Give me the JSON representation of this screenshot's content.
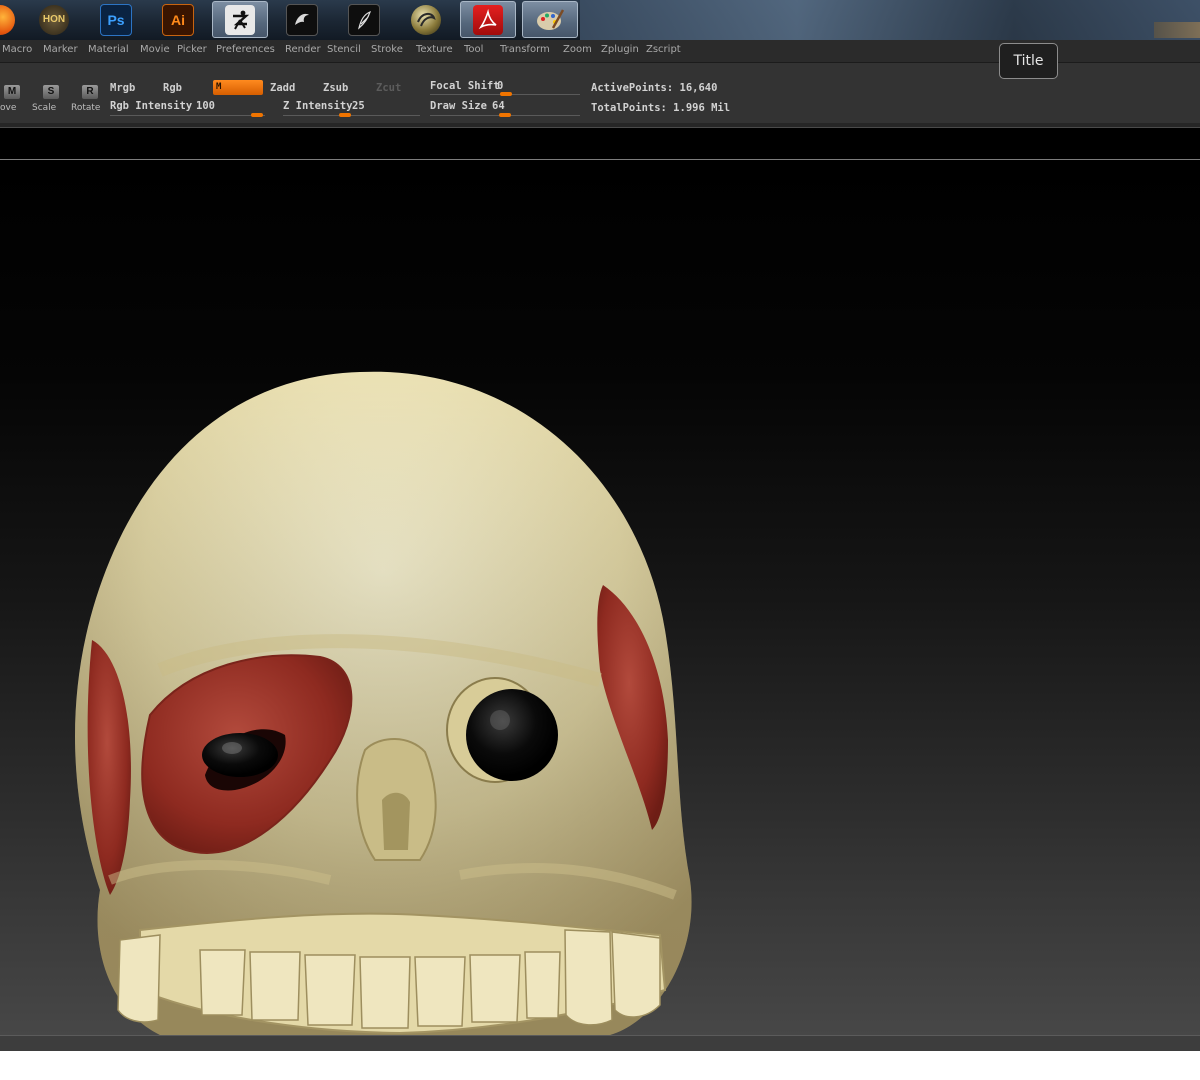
{
  "taskbar": {
    "apps": [
      {
        "name": "firefox",
        "label": ""
      },
      {
        "name": "hon",
        "label": "HON"
      },
      {
        "name": "photoshop",
        "label": "Ps"
      },
      {
        "name": "illustrator",
        "label": "Ai"
      },
      {
        "name": "zbrush",
        "label": "Z",
        "active": true
      },
      {
        "name": "app-dolphin",
        "label": ""
      },
      {
        "name": "app-feather",
        "label": ""
      },
      {
        "name": "app-sphere",
        "label": ""
      },
      {
        "name": "acrobat",
        "label": "⅄",
        "active": true
      },
      {
        "name": "paint",
        "label": "",
        "active": true
      }
    ]
  },
  "menu": {
    "items": [
      "Macro",
      "Marker",
      "Material",
      "Movie",
      "Picker",
      "Preferences",
      "Render",
      "Stencil",
      "Stroke",
      "Texture",
      "Tool",
      "Transform",
      "Zoom",
      "Zplugin",
      "Zscript"
    ]
  },
  "toolbar": {
    "move_short": "M",
    "move_label": "ove",
    "scale_short": "S",
    "scale_label": "Scale",
    "rotate_short": "R",
    "rotate_label": "Rotate",
    "mrgb": "Mrgb",
    "rgb": "Rgb",
    "m_button": "M",
    "zadd": "Zadd",
    "zsub": "Zsub",
    "zcut": "Zcut",
    "rgb_intensity_label": "Rgb Intensity",
    "rgb_intensity_value": "100",
    "z_intensity_label": "Z Intensity",
    "z_intensity_value": "25",
    "focal_shift_label": "Focal Shift",
    "focal_shift_value": "0",
    "draw_size_label": "Draw Size",
    "draw_size_value": "64",
    "active_points": "ActivePoints: 16,640",
    "total_points": "TotalPoints: 1.996 Mil"
  },
  "tooltip": {
    "text": "Title"
  },
  "colors": {
    "accent": "#f07400",
    "bone": "#e8ddb0",
    "muscle": "#9a2d22"
  }
}
